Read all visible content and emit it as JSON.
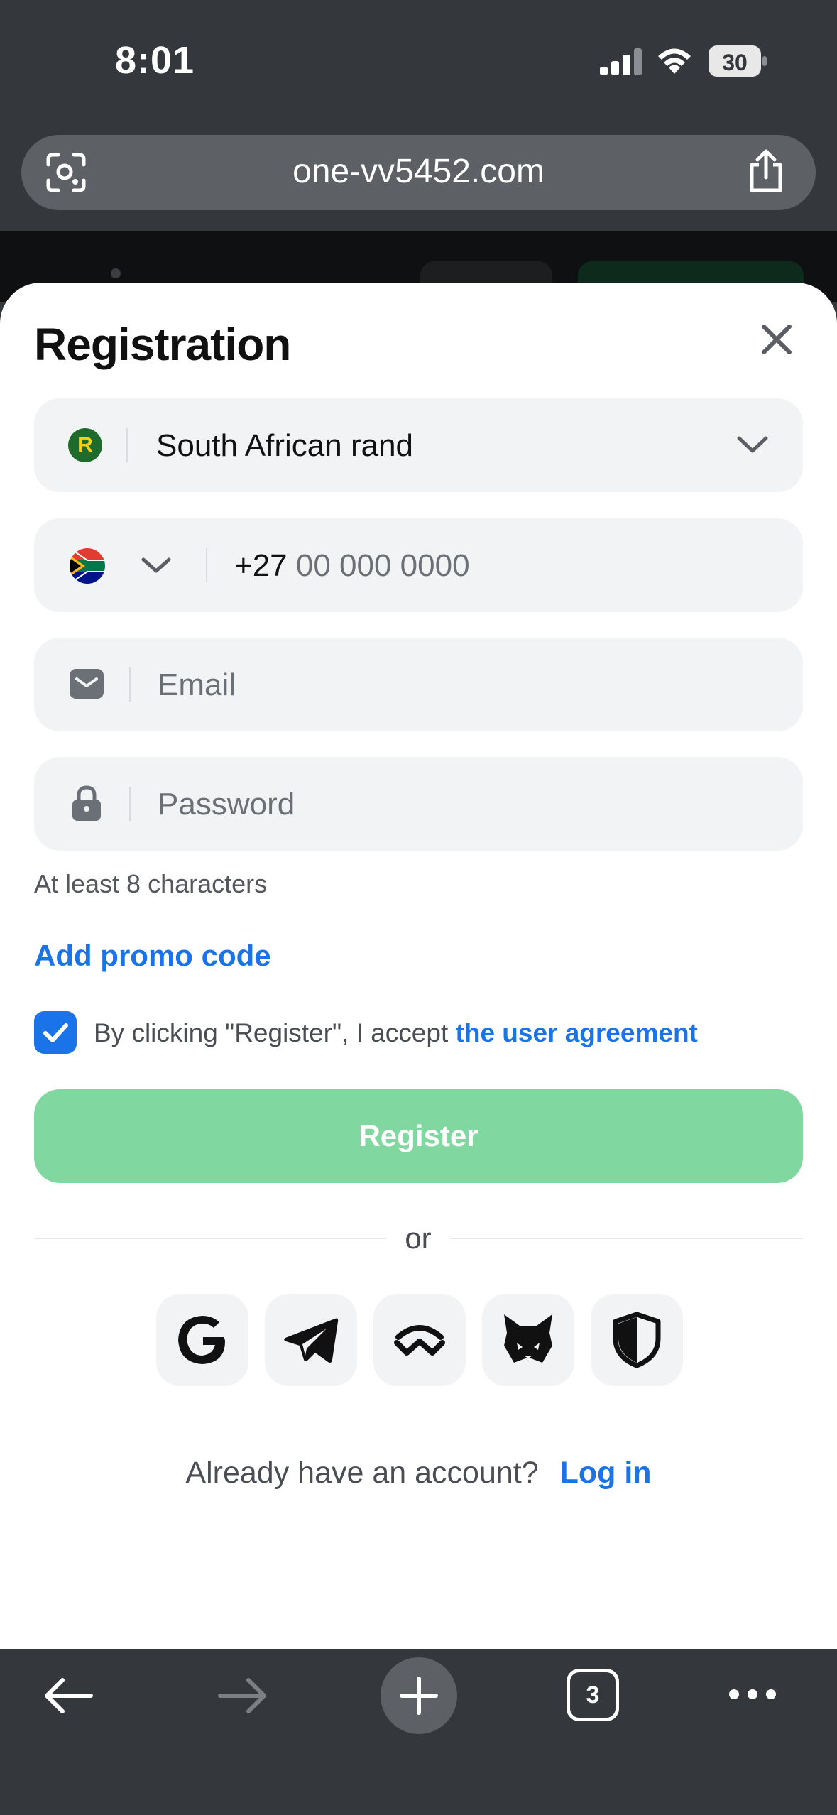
{
  "status_bar": {
    "time": "8:01",
    "battery": "30"
  },
  "browser": {
    "url": "one-vv5452.com",
    "tab_count": "3"
  },
  "modal": {
    "title": "Registration",
    "currency": {
      "badge": "R",
      "value": "South African rand"
    },
    "phone": {
      "prefix": "+27",
      "placeholder": "00 000 0000"
    },
    "email": {
      "placeholder": "Email"
    },
    "password": {
      "placeholder": "Password",
      "hint": "At least 8 characters"
    },
    "promo_label": "Add promo code",
    "agreement": {
      "checked": true,
      "text": "By clicking \"Register\", I accept",
      "link": "the user agreement"
    },
    "register_label": "Register",
    "divider_text": "or",
    "social_icons": [
      "google-icon",
      "telegram-icon",
      "walletconnect-icon",
      "metamask-icon",
      "shield-icon"
    ],
    "account_prompt": "Already have an account?",
    "login_label": "Log in"
  },
  "colors": {
    "accent_blue": "#1a73e8",
    "register_green": "#80d8a0",
    "chrome_dark": "#34373b"
  }
}
